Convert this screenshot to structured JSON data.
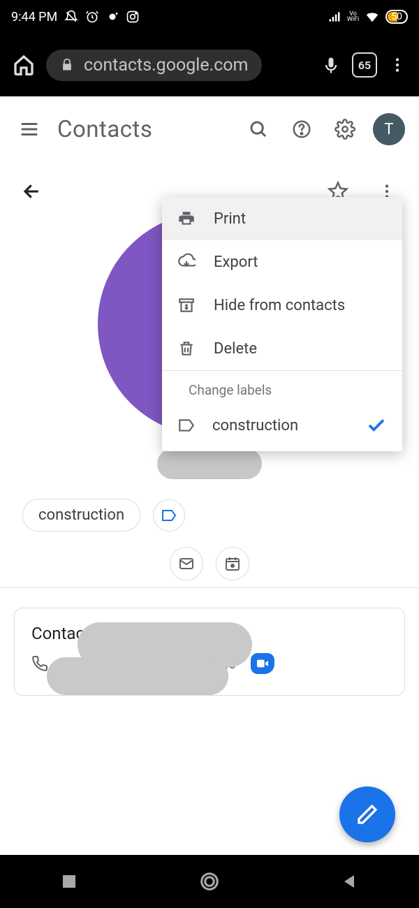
{
  "status": {
    "time": "9:44 PM",
    "vo_top": "Vo",
    "vo_bottom": "WiFi",
    "battery": "50"
  },
  "browser": {
    "url": "contacts.google.com",
    "tabs": "65"
  },
  "header": {
    "title": "Contacts",
    "avatar_letter": "T"
  },
  "menu": {
    "print": "Print",
    "export": "Export",
    "hide": "Hide from contacts",
    "delete": "Delete",
    "change_labels": "Change labels",
    "label_name": "construction"
  },
  "labels": {
    "chip": "construction"
  },
  "card": {
    "title": "Contact details",
    "phone_type": "Mobile"
  }
}
